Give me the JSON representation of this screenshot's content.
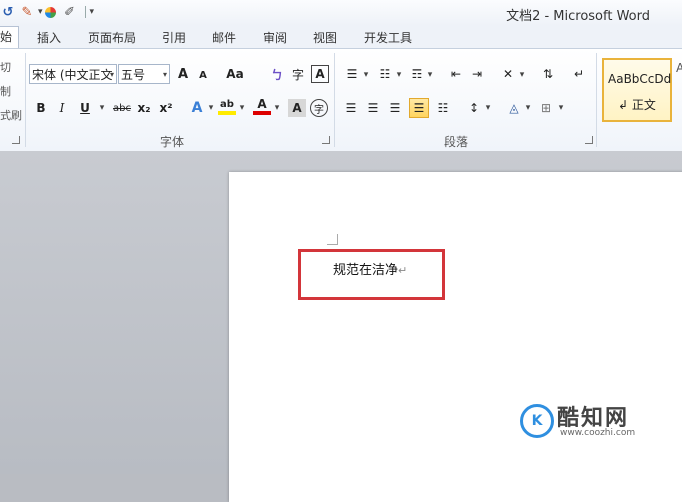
{
  "window": {
    "title": "文档2 - Microsoft Word"
  },
  "qat": {
    "separator_label": "|"
  },
  "tabs": [
    {
      "label": "始",
      "active": true
    },
    {
      "label": "插入"
    },
    {
      "label": "页面布局"
    },
    {
      "label": "引用"
    },
    {
      "label": "邮件"
    },
    {
      "label": "审阅"
    },
    {
      "label": "视图"
    },
    {
      "label": "开发工具"
    }
  ],
  "clipboard": {
    "item1": "切",
    "item2": "制",
    "item3": "式刷"
  },
  "font": {
    "name_value": "宋体 (中文正文",
    "size_value": "五号",
    "grow_label": "A",
    "shrink_label": "A",
    "case_label": "Aa",
    "clear_label": "A",
    "bold_label": "B",
    "italic_label": "I",
    "underline_label": "U",
    "strike_label": "abc",
    "subscript_label": "x₂",
    "superscript_label": "x²",
    "effects_label": "A",
    "highlight_label": "ab",
    "color_label": "A",
    "charshade_label": "A",
    "enclose_label": "字",
    "phonetic_label": "ㄅ",
    "border_label": "A",
    "group_label": "字体"
  },
  "paragraph": {
    "group_label": "段落"
  },
  "styles": {
    "sample": "AaBbCcDd",
    "name": "↲ 正文",
    "next_sample": "A"
  },
  "document": {
    "text": "规范在洁净",
    "para_mark": "↵"
  },
  "watermark": {
    "logo_text": "K",
    "title": "酷知网",
    "url": "www.coozhi.com"
  },
  "colors": {
    "accent": "#2b579a",
    "highlight_box": "#d3353a",
    "active_button": "#ffd45e"
  }
}
